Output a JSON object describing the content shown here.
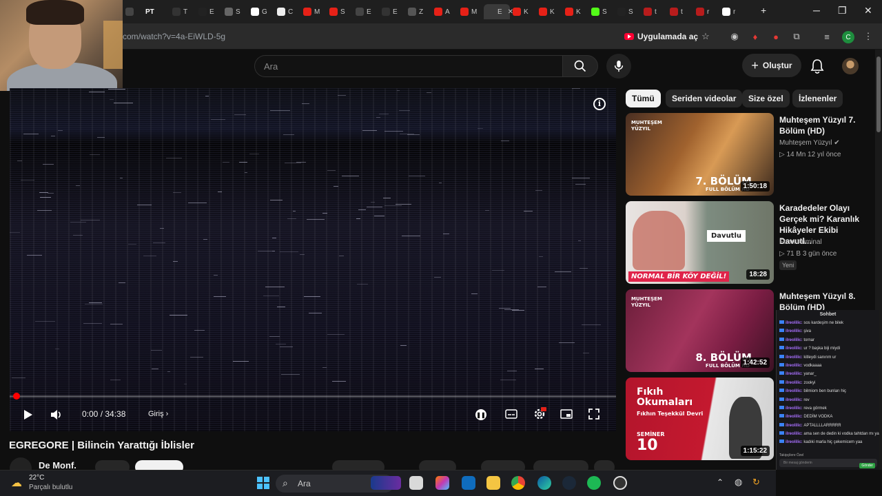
{
  "browser": {
    "tabs": [
      {
        "letter": "T",
        "color": "#333"
      },
      {
        "letter": "E",
        "color": "#222"
      },
      {
        "letter": "S",
        "color": "#666"
      },
      {
        "letter": "G",
        "color": "#fff"
      },
      {
        "letter": "C",
        "color": "#eee"
      },
      {
        "letter": "M",
        "color": "#e62117"
      },
      {
        "letter": "S",
        "color": "#e62117"
      },
      {
        "letter": "E",
        "color": "#444"
      },
      {
        "letter": "E",
        "color": "#333"
      },
      {
        "letter": "Z",
        "color": "#555"
      },
      {
        "letter": "A",
        "color": "#e62117"
      },
      {
        "letter": "M",
        "color": "#e62117"
      },
      {
        "letter": "E",
        "color": "#3a3a3a"
      },
      {
        "letter": "K",
        "color": "#e62117"
      },
      {
        "letter": "K",
        "color": "#e62117"
      },
      {
        "letter": "K",
        "color": "#e62117"
      },
      {
        "letter": "S",
        "color": "#53fc18"
      },
      {
        "letter": "S",
        "color": "#222"
      },
      {
        "letter": "t",
        "color": "#b71c1c"
      },
      {
        "letter": "t",
        "color": "#b71c1c"
      },
      {
        "letter": "r",
        "color": "#b71c1c"
      },
      {
        "letter": "r",
        "color": "#fff"
      }
    ],
    "prefix_label": "PT",
    "url": "com/watch?v=4a-EiWLD-5g",
    "open_in_app": "Uygulamada aç",
    "profile_initial": "C"
  },
  "youtube": {
    "search_placeholder": "Ara",
    "create_label": "Oluştur",
    "chips": [
      "Tümü",
      "Seriden videolar",
      "Size özel",
      "İzlenenler"
    ],
    "video": {
      "time": "0:00 / 34:38",
      "chapter": "Giriş",
      "title": "EGREGORE | Bilincin Yarattığı İblisler",
      "channel": "De Monf."
    },
    "recommendations": [
      {
        "title": "Muhteşem Yüzyıl 7. Bölüm (HD)",
        "channel": "Muhteşem Yüzyıl",
        "meta": "▷ 14 Mn   12 yıl önce",
        "duration": "1:50:18",
        "thumb_text": "7. BÖLÜM",
        "thumb_sub": "FULL BÖLÜM HD",
        "thumb_brand": "MUHTEŞEM YÜZYIL"
      },
      {
        "title": "Karadedeler Olayı Gerçek mi? Karanlık Hikâyeler Ekibi Davutl...",
        "channel": "Foon Kriminal",
        "meta": "▷ 71 B   3 gün önce",
        "badge": "Yeni",
        "duration": "18:28",
        "thumb_text": "NORMAL BİR KÖY DEĞİL!",
        "thumb_sign": "Davutlu"
      },
      {
        "title": "Muhteşem Yüzyıl 8. Bölüm (HD)",
        "duration": "1:42:52",
        "thumb_text": "8. BÖLÜM",
        "thumb_sub": "FULL BÖLÜM HD",
        "thumb_brand": "MUHTEŞEM YÜZYIL"
      },
      {
        "duration": "1:15:22",
        "thumb_title": "Fıkıh Okumaları",
        "thumb_sub": "Fıkhın Teşekkül Devri",
        "thumb_label": "SEMİNER",
        "thumb_num": "10"
      }
    ]
  },
  "chat": {
    "title": "Sohbet",
    "lines": [
      {
        "user": "ilreolilic:",
        "msg": "sos kardeşim ne bilek"
      },
      {
        "user": "ilreolilic:",
        "msg": "şiva"
      },
      {
        "user": "ilreolilic:",
        "msg": "tornar"
      },
      {
        "user": "ilreolilic:",
        "msg": "ur ? başka biji miydi"
      },
      {
        "user": "ilreolilic:",
        "msg": "kitleydi sanırım ur"
      },
      {
        "user": "ilreolilic:",
        "msg": "vodkaaaa"
      },
      {
        "user": "ilreolilic:",
        "msg": "yanar_"
      },
      {
        "user": "ilreolilic:",
        "msg": "zookyi"
      },
      {
        "user": "ilreolilic:",
        "msg": "bilmiom ben bunları hiç"
      },
      {
        "user": "ilreolilic:",
        "msg": "rev"
      },
      {
        "user": "ilreolilic:",
        "msg": "reva görmek"
      },
      {
        "user": "ilreolilic:",
        "msg": "DEDİM VODKA"
      },
      {
        "user": "ilreolilic:",
        "msg": "APTALLLLARRRRR"
      },
      {
        "user": "ilreolilic:",
        "msg": "ama sen de dedin ki vodka tahtdan mı yapıyo"
      },
      {
        "user": "ilreolilic:",
        "msg": "kadıki marla hiç çekemicem yaa"
      }
    ],
    "footer": "Takipçilere Özel",
    "input_placeholder": "Bir mesaj gönderin",
    "send_label": "Gönder"
  },
  "taskbar": {
    "temp": "22°C",
    "weather": "Parçalı bulutlu",
    "search": "Ara"
  }
}
